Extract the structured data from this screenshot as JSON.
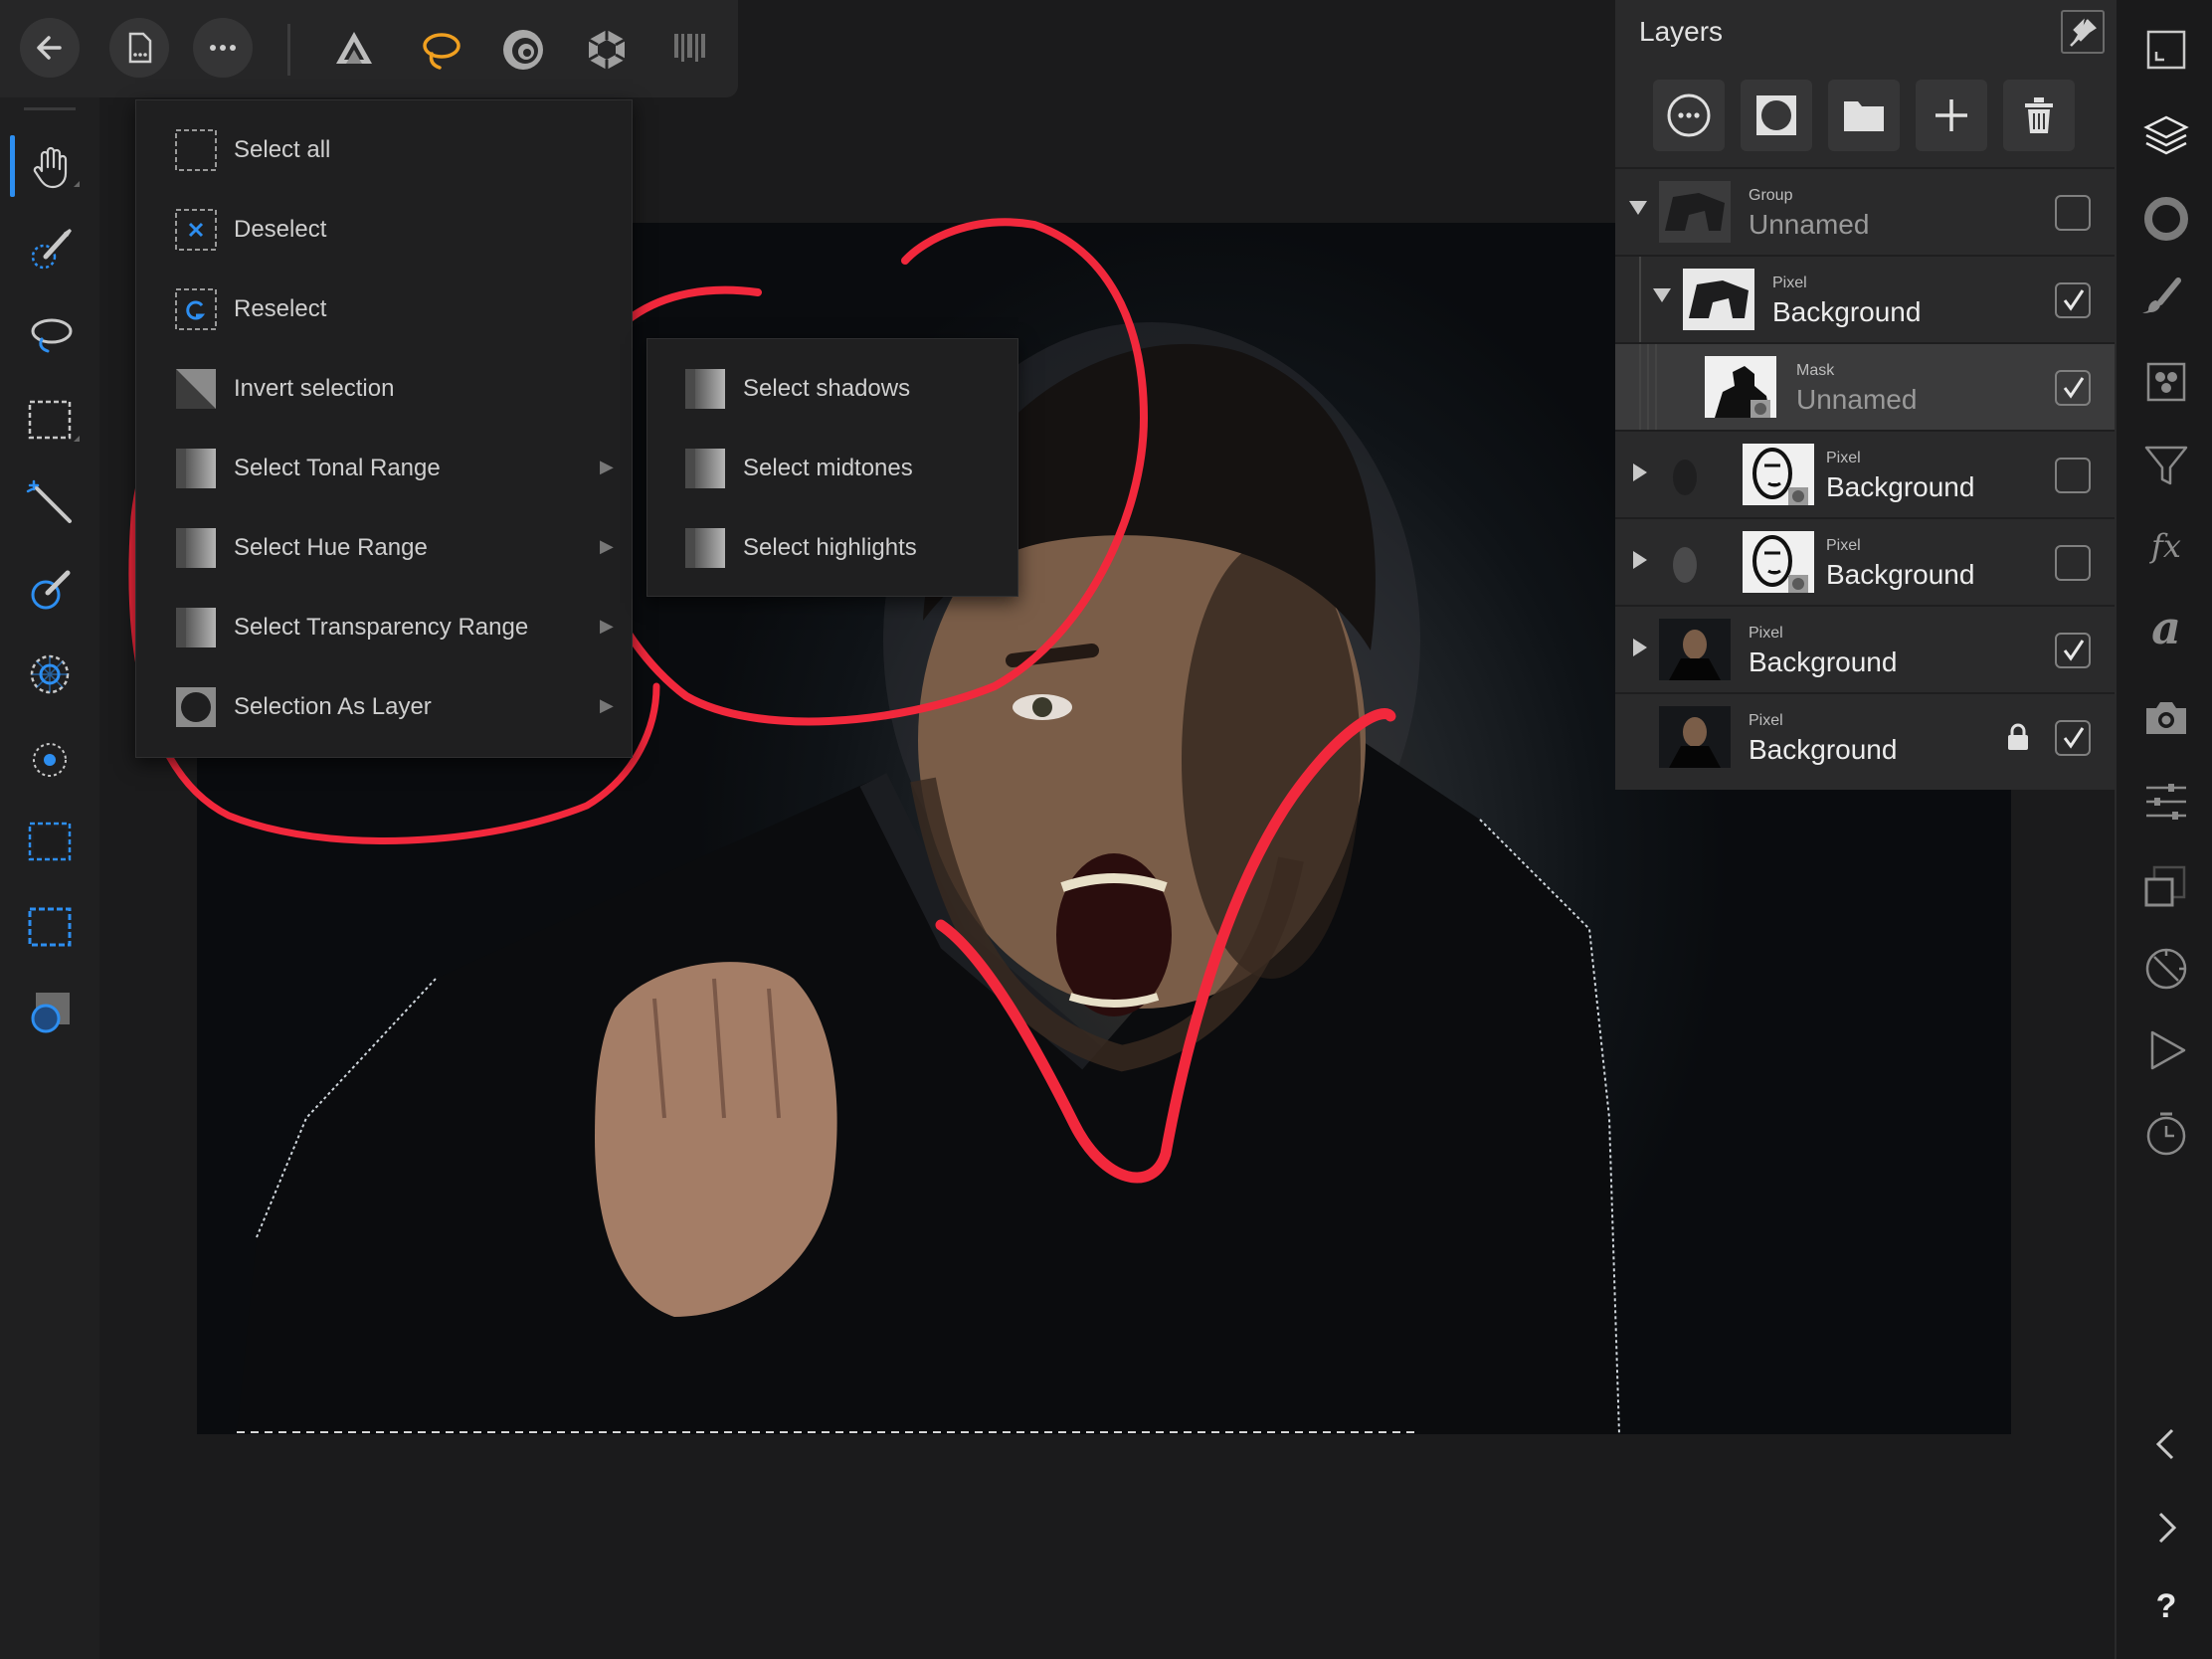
{
  "toolbar": {
    "left_buttons": [
      "back-icon",
      "document-icon",
      "more-icon"
    ],
    "personas": [
      "photo-persona-icon",
      "selection-persona-icon",
      "liquify-persona-icon",
      "develop-persona-icon",
      "export-persona-icon"
    ],
    "active_persona_color": "#f0a020"
  },
  "left_tools": [
    "hand-tool-icon",
    "selection-brush-icon",
    "freehand-selection-icon",
    "rectangular-marquee-icon",
    "flood-select-icon",
    "selection-refine-icon",
    "grow-selection-icon",
    "select-sampled-color-icon",
    "selection-from-layer-icon",
    "marquee-options-icon",
    "quick-mask-icon"
  ],
  "accent_color": "#2d8ef0",
  "selection_menu": {
    "items": [
      {
        "label": "Select all",
        "icon": "select-all-icon",
        "has_submenu": false
      },
      {
        "label": "Deselect",
        "icon": "deselect-icon",
        "has_submenu": false
      },
      {
        "label": "Reselect",
        "icon": "reselect-icon",
        "has_submenu": false
      },
      {
        "label": "Invert selection",
        "icon": "invert-selection-icon",
        "has_submenu": false
      },
      {
        "label": "Select Tonal Range",
        "icon": "tonal-range-icon",
        "has_submenu": true
      },
      {
        "label": "Select Hue Range",
        "icon": "hue-range-icon",
        "has_submenu": true
      },
      {
        "label": "Select Transparency Range",
        "icon": "transparency-range-icon",
        "has_submenu": true
      },
      {
        "label": "Selection As Layer",
        "icon": "selection-as-layer-icon",
        "has_submenu": true
      }
    ],
    "submenu_arrow": "▶"
  },
  "tonal_submenu": {
    "items": [
      {
        "label": "Select shadows",
        "icon": "shadows-icon"
      },
      {
        "label": "Select midtones",
        "icon": "midtones-icon"
      },
      {
        "label": "Select highlights",
        "icon": "highlights-icon"
      }
    ]
  },
  "layers_panel": {
    "title": "Layers",
    "action_buttons": [
      "layer-options-icon",
      "mask-layer-icon",
      "group-folder-icon",
      "add-layer-icon",
      "delete-layer-icon"
    ],
    "rows": [
      {
        "kind": "Group",
        "name": "Unnamed",
        "visible": false,
        "expanded": true,
        "locked": false
      },
      {
        "kind": "Pixel",
        "name": "Background",
        "visible": true,
        "expanded": true,
        "locked": false
      },
      {
        "kind": "Mask",
        "name": "Unnamed",
        "visible": true,
        "selected": true,
        "locked": false
      },
      {
        "kind": "Pixel",
        "name": "Background",
        "visible": false,
        "expanded": false,
        "locked": false
      },
      {
        "kind": "Pixel",
        "name": "Background",
        "visible": false,
        "expanded": false,
        "locked": false
      },
      {
        "kind": "Pixel",
        "name": "Background",
        "visible": true,
        "expanded": false,
        "locked": false
      },
      {
        "kind": "Pixel",
        "name": "Background",
        "visible": true,
        "locked": true
      }
    ]
  },
  "right_studio": {
    "icons": [
      "navigator-icon",
      "layers-icon",
      "color-icon",
      "brushes-icon",
      "channels-icon",
      "adjustments-filter-icon",
      "fx-effects-icon",
      "text-styles-icon",
      "stock-camera-icon",
      "transform-sliders-icon",
      "history-snapshot-icon",
      "no-navigator-icon",
      "play-macro-icon",
      "history-clock-icon",
      "collapse-left-icon",
      "collapse-right-icon",
      "help-icon"
    ],
    "fx_label": "fx",
    "text_label": "a",
    "help_label": "?"
  },
  "annotation_color": "#f2283c"
}
